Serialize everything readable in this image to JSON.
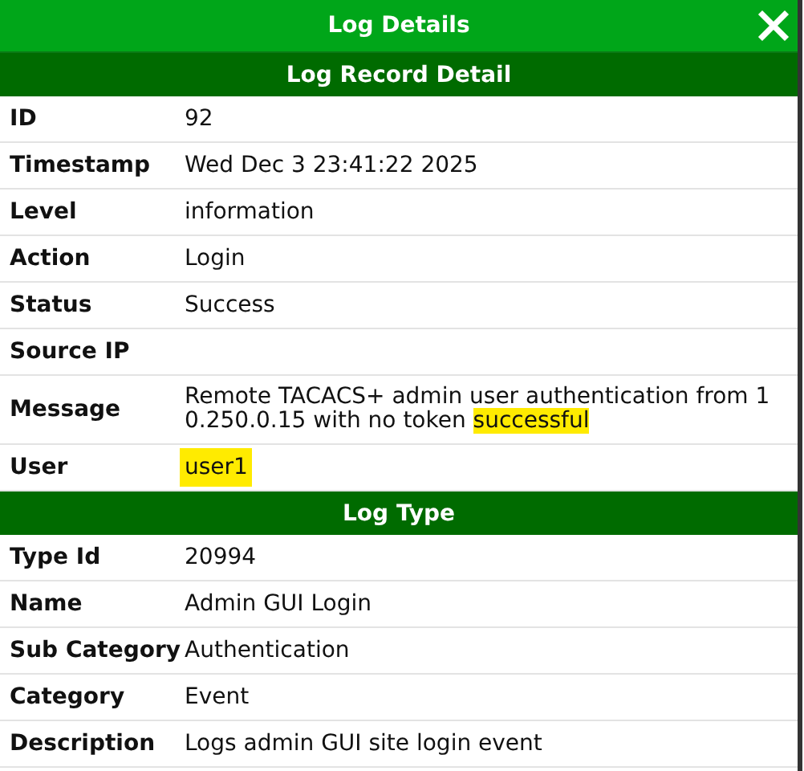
{
  "window": {
    "title": "Log Details"
  },
  "sections": [
    {
      "title": "Log Record Detail",
      "rows": [
        {
          "label": "ID",
          "value": "92"
        },
        {
          "label": "Timestamp",
          "value": "Wed Dec 3 23:41:22 2025"
        },
        {
          "label": "Level",
          "value": "information"
        },
        {
          "label": "Action",
          "value": "Login"
        },
        {
          "label": "Status",
          "value": "Success"
        },
        {
          "label": "Source IP"
        },
        {
          "label": "Message",
          "segments": [
            {
              "text": "Remote TACACS+ admin user authentication from 10.250.0.15 with no token ",
              "highlighted": false
            },
            {
              "text": "successful",
              "highlighted": true
            }
          ]
        },
        {
          "label": "User",
          "value": "user1",
          "highlighted": true
        }
      ]
    },
    {
      "title": "Log Type",
      "rows": [
        {
          "label": "Type Id",
          "value": "20994"
        },
        {
          "label": "Name",
          "value": "Admin GUI Login"
        },
        {
          "label": "Sub Category",
          "value": "Authentication"
        },
        {
          "label": "Category",
          "value": "Event"
        },
        {
          "label": "Description",
          "value": "Logs admin GUI site login event"
        }
      ]
    }
  ]
}
